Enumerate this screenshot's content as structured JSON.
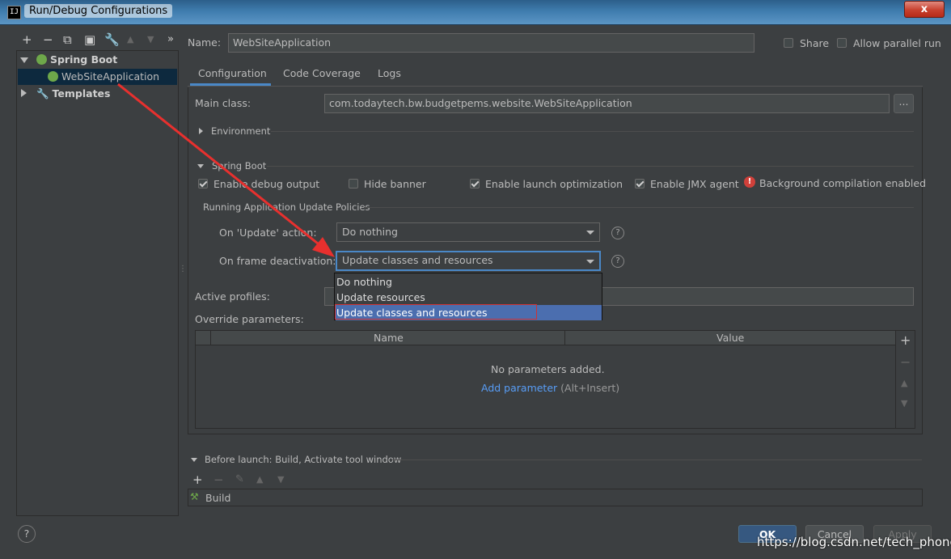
{
  "window": {
    "title": "Run/Debug Configurations",
    "app_icon": "IJ",
    "close_symbol": "x"
  },
  "left_toolbar": {
    "icons": [
      "+",
      "−",
      "⧉",
      "▣",
      "🔧",
      "▲",
      "▼",
      "»"
    ]
  },
  "tree": {
    "spring_boot": "Spring Boot",
    "app": "WebSiteApplication",
    "templates": "Templates"
  },
  "header": {
    "name_label": "Name:",
    "name_value": "WebSiteApplication",
    "share_label": "Share",
    "allow_parallel_label": "Allow parallel run"
  },
  "tabs": [
    "Configuration",
    "Code Coverage",
    "Logs"
  ],
  "config": {
    "main_class_label": "Main class:",
    "main_class_value": "com.todaytech.bw.budgetpems.website.WebSiteApplication",
    "browse_button": "...",
    "environment_label": "Environment",
    "spring_boot_section": "Spring Boot",
    "checkboxes": [
      {
        "label": "Enable debug output",
        "checked": true
      },
      {
        "label": "Hide banner",
        "checked": false
      },
      {
        "label": "Enable launch optimization",
        "checked": true
      },
      {
        "label": "Enable JMX agent",
        "checked": true
      }
    ],
    "bg_compilation": "Background compilation enabled",
    "update_policies_label": "Running Application Update Policies",
    "on_update_label": "On 'Update' action:",
    "on_update_value": "Do nothing",
    "on_frame_label": "On frame deactivation:",
    "on_frame_value": "Update classes and resources",
    "help_symbol": "?",
    "dropdown_options": [
      "Do nothing",
      "Update resources",
      "Update classes and resources"
    ],
    "active_profiles_label": "Active profiles:",
    "override_label": "Override parameters:",
    "table_headers": [
      "Name",
      "Value"
    ],
    "empty_text": "No parameters added.",
    "add_param_link": "Add parameter",
    "add_param_shortcut": "(Alt+Insert)",
    "table_side": [
      "+",
      "−",
      "▲",
      "▼"
    ]
  },
  "before_launch": {
    "title": "Before launch: Build, Activate tool window",
    "toolbar": [
      "+",
      "−",
      "✎",
      "▲",
      "▼"
    ],
    "task": "Build"
  },
  "footer": {
    "help": "?",
    "ok": "OK",
    "cancel": "Cancel",
    "apply": "Apply",
    "watermark": "https://blog.csdn.net/tech_phone"
  },
  "colors": {
    "accent": "#4a88c7",
    "selection": "#4b6eaf",
    "arrow": "#e8302e",
    "link": "#589df6"
  }
}
